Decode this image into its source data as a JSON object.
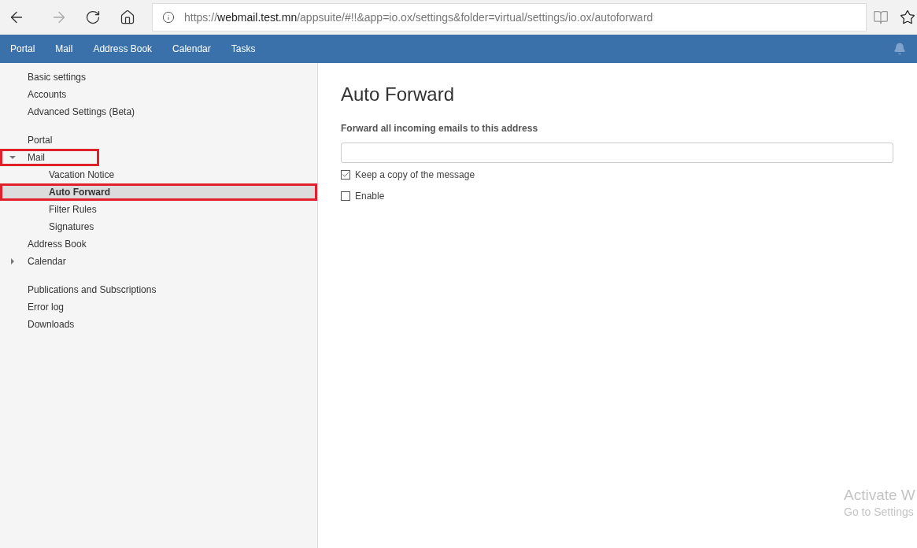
{
  "browser": {
    "url_prefix": "https://",
    "url_host": "webmail.test.mn",
    "url_path": "/appsuite/#!!&app=io.ox/settings&folder=virtual/settings/io.ox/autoforward"
  },
  "nav": {
    "items": [
      {
        "label": "Portal"
      },
      {
        "label": "Mail"
      },
      {
        "label": "Address Book"
      },
      {
        "label": "Calendar"
      },
      {
        "label": "Tasks"
      }
    ]
  },
  "sidebar": {
    "groups": [
      [
        {
          "label": "Basic settings",
          "selected": false,
          "annotated": false
        },
        {
          "label": "Accounts",
          "selected": false,
          "annotated": false
        },
        {
          "label": "Advanced Settings (Beta)",
          "selected": false,
          "annotated": false
        }
      ],
      [
        {
          "label": "Portal",
          "selected": false,
          "annotated": false
        },
        {
          "label": "Mail",
          "expanded": true,
          "selected": false,
          "annotated": true,
          "children": [
            {
              "label": "Vacation Notice",
              "selected": false,
              "annotated": false
            },
            {
              "label": "Auto Forward",
              "selected": true,
              "annotated": true
            },
            {
              "label": "Filter Rules",
              "selected": false,
              "annotated": false
            },
            {
              "label": "Signatures",
              "selected": false,
              "annotated": false
            }
          ]
        },
        {
          "label": "Address Book",
          "selected": false,
          "annotated": false
        },
        {
          "label": "Calendar",
          "expanded": false,
          "selected": false,
          "annotated": false
        }
      ],
      [
        {
          "label": "Publications and Subscriptions",
          "selected": false,
          "annotated": false
        },
        {
          "label": "Error log",
          "selected": false,
          "annotated": false
        },
        {
          "label": "Downloads",
          "selected": false,
          "annotated": false
        }
      ]
    ]
  },
  "content": {
    "title": "Auto Forward",
    "field": {
      "label": "Forward all incoming emails to this address"
    },
    "options": [
      {
        "label": "Keep a copy of the message",
        "checked": true
      },
      {
        "label": "Enable",
        "checked": false
      }
    ]
  },
  "os_notice": {
    "title": "Activate W",
    "subtitle": "Go to Settings"
  }
}
